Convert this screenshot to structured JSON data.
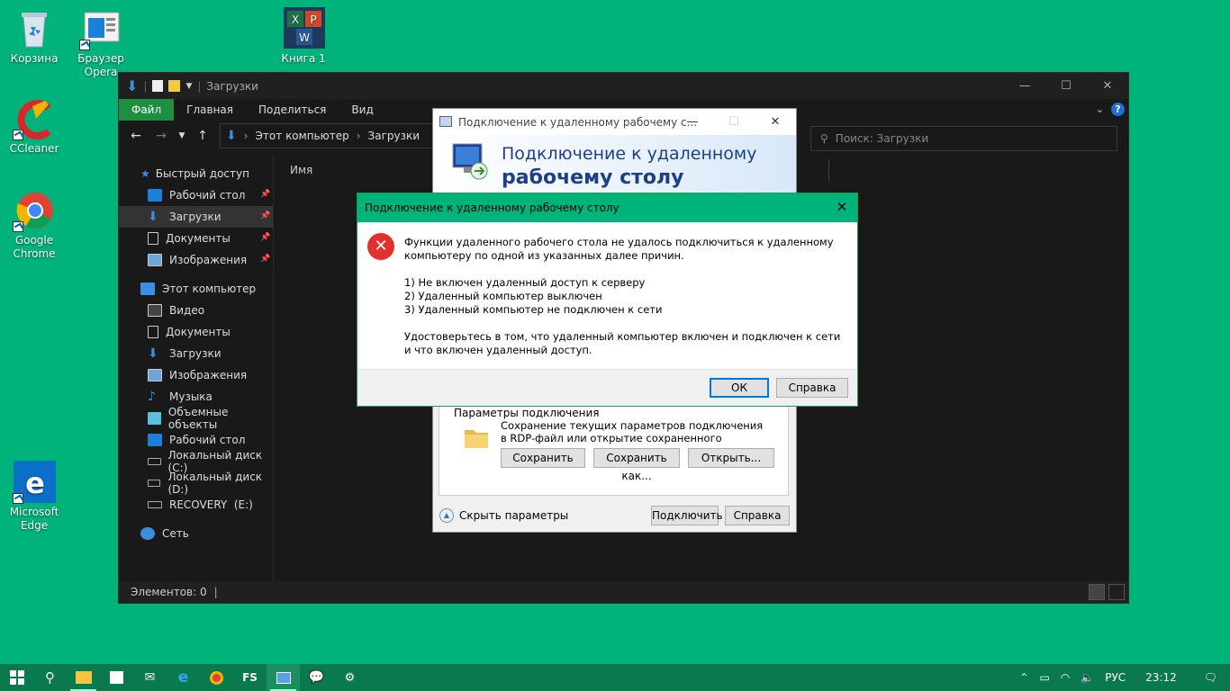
{
  "desktop": {
    "icons": [
      {
        "label": "Корзина"
      },
      {
        "label": "Браузер Opera"
      },
      {
        "label": "Книга 1"
      },
      {
        "label": "CCleaner"
      },
      {
        "label": "Google Chrome"
      },
      {
        "label": "Microsoft Edge"
      }
    ]
  },
  "explorer": {
    "title": "Загрузки",
    "ribbon_tabs": [
      "Файл",
      "Главная",
      "Поделиться",
      "Вид"
    ],
    "breadcrumb": [
      "Этот компьютер",
      "Загрузки"
    ],
    "search_placeholder": "Поиск: Загрузки",
    "column_name": "Имя",
    "quick_access": "Быстрый доступ",
    "quick_items": [
      "Рабочий стол",
      "Загрузки",
      "Документы",
      "Изображения"
    ],
    "this_pc": "Этот компьютер",
    "pc_items": [
      "Видео",
      "Документы",
      "Загрузки",
      "Изображения",
      "Музыка",
      "Объемные объекты",
      "Рабочий стол",
      "Локальный диск (C:)",
      "Локальный диск (D:)",
      "RECOVERY  (E:)"
    ],
    "network": "Сеть",
    "status": "Элементов: 0"
  },
  "rdp": {
    "title": "Подключение к удаленному рабочему с...",
    "banner_line1": "Подключение к удаленному",
    "banner_line2": "рабочему столу",
    "group_title": "Параметры подключения",
    "group_text": "Сохранение текущих параметров подключения в RDP-файл или открытие сохраненного подключения.",
    "save": "Сохранить",
    "save_as": "Сохранить как...",
    "open": "Открыть...",
    "hide_params": "Скрыть параметры",
    "connect": "Подключить",
    "help": "Справка"
  },
  "error_dialog": {
    "title": "Подключение к удаленному рабочему столу",
    "para1": "Функции удаленного рабочего стола не удалось подключиться к удаленному компьютеру по одной из указанных далее причин.",
    "reason1": "1) Не включен удаленный доступ к серверу",
    "reason2": "2) Удаленный компьютер выключен",
    "reason3": "3) Удаленный компьютер не подключен к сети",
    "para2": "Удостоверьтесь в том, что удаленный компьютер включен и подключен к сети и что включен удаленный доступ.",
    "ok": "ОК",
    "help": "Справка"
  },
  "taskbar": {
    "fs_label": "FS",
    "lang": "РУС",
    "time": "23:12"
  }
}
